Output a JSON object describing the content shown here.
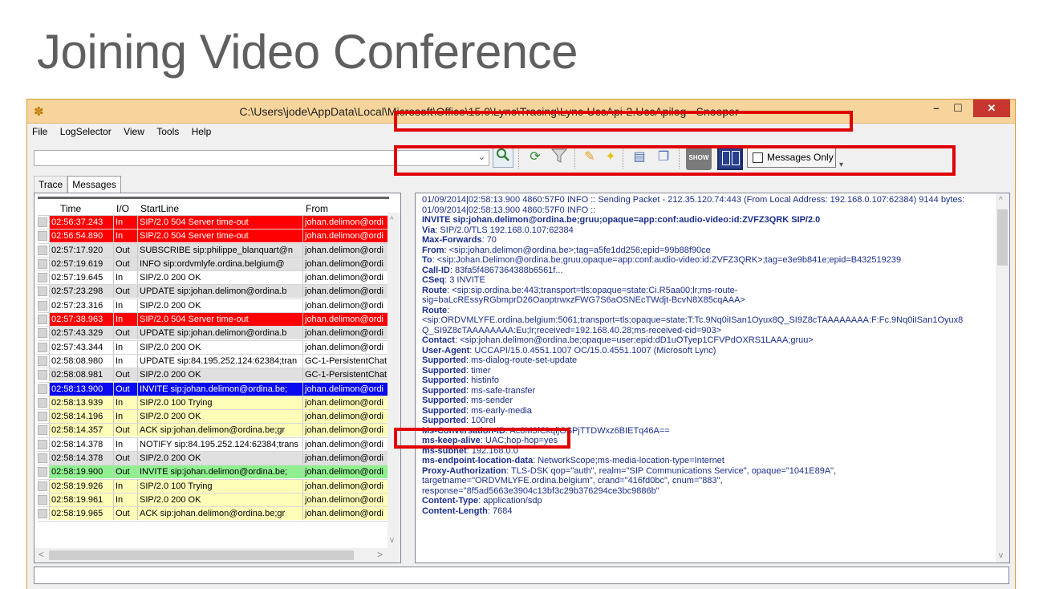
{
  "slide": {
    "title": "Joining Video Conference"
  },
  "window": {
    "title": "C:\\Users\\jode\\AppData\\Local\\Microsoft\\Office\\15.0\\Lync\\Tracing\\Lync-UccApi-2.UccApilog - Snooper",
    "controls": {
      "minimize": "–",
      "maximize": "☐",
      "close": "✕"
    },
    "icon": "bug-icon"
  },
  "menu": [
    "File",
    "LogSelector",
    "View",
    "Tools",
    "Help"
  ],
  "toolbar": {
    "search_value": "",
    "show_label": "SHOW",
    "messages_only_label": "Messages Only",
    "messages_only_checked": false,
    "icons": [
      "search-icon",
      "refresh-icon",
      "filter-icon",
      "marker-icon",
      "pin-icon",
      "document-icon",
      "copy-icon",
      "show-icon",
      "panes-icon"
    ]
  },
  "tabs": [
    {
      "label": "Trace",
      "active": false
    },
    {
      "label": "Messages",
      "active": true
    }
  ],
  "grid": {
    "columns": [
      "Time",
      "I/O",
      "StartLine",
      "From"
    ],
    "rows": [
      {
        "time": "02:56:37.243",
        "io": "In",
        "start": "SIP/2.0 504 Server time-out",
        "from": "johan.delimon@ordi",
        "color": "red"
      },
      {
        "time": "02:56:54.890",
        "io": "In",
        "start": "SIP/2.0 504 Server time-out",
        "from": "johan.delimon@ordi",
        "color": "red"
      },
      {
        "time": "02:57:17.920",
        "io": "Out",
        "start": "SUBSCRIBE sip:philippe_blanquart@n",
        "from": "johan.delimon@ordi",
        "color": "gray"
      },
      {
        "time": "02:57:19.619",
        "io": "Out",
        "start": "INFO sip:ordvmlyfe.ordina.belgium@",
        "from": "johan.delimon@ordi",
        "color": "gray"
      },
      {
        "time": "02:57:19.645",
        "io": "In",
        "start": "SIP/2.0 200 OK",
        "from": "johan.delimon@ordi",
        "color": "white"
      },
      {
        "time": "02:57:23.298",
        "io": "Out",
        "start": "UPDATE sip:johan.delimon@ordina.b",
        "from": "johan.delimon@ordi",
        "color": "gray"
      },
      {
        "time": "02:57:23.316",
        "io": "In",
        "start": "SIP/2.0 200 OK",
        "from": "johan.delimon@ordi",
        "color": "white"
      },
      {
        "time": "02:57:38.963",
        "io": "In",
        "start": "SIP/2.0 504 Server time-out",
        "from": "johan.delimon@ordi",
        "color": "red"
      },
      {
        "time": "02:57:43.329",
        "io": "Out",
        "start": "UPDATE sip:johan.delimon@ordina.b",
        "from": "johan.delimon@ordi",
        "color": "gray"
      },
      {
        "time": "02:57:43.344",
        "io": "In",
        "start": "SIP/2.0 200 OK",
        "from": "johan.delimon@ordi",
        "color": "white"
      },
      {
        "time": "02:58:08.980",
        "io": "In",
        "start": "UPDATE sip:84.195.252.124:62384;tran",
        "from": "GC-1-PersistentChat",
        "color": "white"
      },
      {
        "time": "02:58:08.981",
        "io": "Out",
        "start": "SIP/2.0 200 OK",
        "from": "GC-1-PersistentChat",
        "color": "gray"
      },
      {
        "time": "02:58:13.900",
        "io": "Out",
        "start": "INVITE sip:johan.delimon@ordina.be;",
        "from": "johan.delimon@ordi",
        "color": "blue"
      },
      {
        "time": "02:58:13.939",
        "io": "In",
        "start": "SIP/2.0 100 Trying",
        "from": "johan.delimon@ordi",
        "color": "yellow"
      },
      {
        "time": "02:58:14.196",
        "io": "In",
        "start": "SIP/2.0 200 OK",
        "from": "johan.delimon@ordi",
        "color": "yellow"
      },
      {
        "time": "02:58:14.357",
        "io": "Out",
        "start": "ACK sip:johan.delimon@ordina.be;gr",
        "from": "johan.delimon@ordi",
        "color": "yellow"
      },
      {
        "time": "02:58:14.378",
        "io": "In",
        "start": "NOTIFY sip:84.195.252.124:62384;trans",
        "from": "johan.delimon@ordi",
        "color": "white"
      },
      {
        "time": "02:58:14.378",
        "io": "Out",
        "start": "SIP/2.0 200 OK",
        "from": "johan.delimon@ordi",
        "color": "gray"
      },
      {
        "time": "02:58:19.900",
        "io": "Out",
        "start": "INVITE sip:johan.delimon@ordina.be;",
        "from": "johan.delimon@ordi",
        "color": "green"
      },
      {
        "time": "02:58:19.926",
        "io": "In",
        "start": "SIP/2.0 100 Trying",
        "from": "johan.delimon@ordi",
        "color": "yellow"
      },
      {
        "time": "02:58:19.961",
        "io": "In",
        "start": "SIP/2.0 200 OK",
        "from": "johan.delimon@ordi",
        "color": "yellow"
      },
      {
        "time": "02:58:19.965",
        "io": "Out",
        "start": "ACK sip:johan.delimon@ordina.be;gr",
        "from": "johan.delimon@ordi",
        "color": "yellow"
      }
    ]
  },
  "detail": {
    "lines": [
      {
        "k": "",
        "v": "01/09/2014|02:58:13.900 4860:57F0 INFO :: Sending Packet - 212.35.120.74:443 (From Local Address: 192.168.0.107:62384) 9144 bytes:"
      },
      {
        "k": "",
        "v": "01/09/2014|02:58:13.900 4860:57F0 INFO ::"
      },
      {
        "k": "INVITE sip:johan.delimon@ordina.be;gruu;opaque=app:conf:audio-video:id:ZVFZ3QRK SIP/2.0",
        "v": ""
      },
      {
        "k": "Via",
        "v": ": SIP/2.0/TLS 192.168.0.107:62384"
      },
      {
        "k": "Max-Forwards",
        "v": ": 70"
      },
      {
        "k": "From",
        "v": ": <sip:johan.delimon@ordina.be>;tag=a5fe1dd256;epid=99b88f90ce"
      },
      {
        "k": "To",
        "v": ": <sip:Johan.Delimon@ordina.be;gruu;opaque=app:conf:audio-video:id:ZVFZ3QRK>;tag=e3e9b841e;epid=B432519239"
      },
      {
        "k": "Call-ID",
        "v": ": 83fa5f4867364388b6561f..."
      },
      {
        "k": "CSeq",
        "v": ": 3 INVITE"
      },
      {
        "k": "Route",
        "v": ": <sip:sip.ordina.be:443;transport=tls;opaque=state:Ci.R5aa00;lr;ms-route-"
      },
      {
        "k": "",
        "v": "sig=baLcREssyRGbmprD26OaoptrwxzFWG7S6aOSNEcTWdjt-BcvN8X85cqAAA>"
      },
      {
        "k": "Route",
        "v": ":"
      },
      {
        "k": "",
        "v": "<sip:ORDVMLYFE.ordina.belgium:5061;transport=tls;opaque=state:T:Tc.9Nq0iISan1Oyux8Q_SI9Z8cTAAAAAAAA:F:Fc.9Nq0iISan1Oyux8"
      },
      {
        "k": "",
        "v": "Q_SI9Z8cTAAAAAAAA:Eu;lr;received=192.168.40.28;ms-received-cid=903>"
      },
      {
        "k": "Contact",
        "v": ": <sip:johan.delimon@ordina.be;opaque=user:epid:dD1uOTyep1CFVPdOXRS1LAAA;gruu>"
      },
      {
        "k": "User-Agent",
        "v": ": UCCAPI/15.0.4551.1007 OC/15.0.4551.1007 (Microsoft Lync)"
      },
      {
        "k": "Supported",
        "v": ": ms-dialog-route-set-update"
      },
      {
        "k": "Supported",
        "v": ": timer"
      },
      {
        "k": "Supported",
        "v": ": histinfo"
      },
      {
        "k": "Supported",
        "v": ": ms-safe-transfer"
      },
      {
        "k": "Supported",
        "v": ": ms-sender"
      },
      {
        "k": "Supported",
        "v": ": ms-early-media"
      },
      {
        "k": "Supported",
        "v": ": 100rel"
      },
      {
        "k": "Ms-Conversation-ID",
        "v": ": Ac8M3fCkqljGSPjTTDWxz6BIETq46A=="
      },
      {
        "k": "ms-keep-alive",
        "v": ": UAC;hop-hop=yes"
      },
      {
        "k": "ms-subnet",
        "v": ": 192.168.0.0"
      },
      {
        "k": "ms-endpoint-location-data",
        "v": ": NetworkScope;ms-media-location-type=Internet"
      },
      {
        "k": "Proxy-Authorization",
        "v": ": TLS-DSK qop=\"auth\", realm=\"SIP Communications Service\", opaque=\"1041E89A\","
      },
      {
        "k": "",
        "v": "targetname=\"ORDVMLYFE.ordina.belgium\", crand=\"416fd0bc\", cnum=\"883\","
      },
      {
        "k": "",
        "v": "response=\"8f5ad5663e3904c13bf3c29b376294ce3bc9886b\""
      },
      {
        "k": "Content-Type",
        "v": ": application/sdp"
      },
      {
        "k": "Content-Length",
        "v": ": 7684"
      }
    ]
  },
  "status": {
    "text": ""
  },
  "colors": {
    "red": "#fe0000",
    "yellow": "#fdfdb7",
    "gray": "#e0e0e0",
    "blue": "#0a0af0",
    "green": "#90f090",
    "highlight": "#e00000",
    "detail_text": "#1b2e8c"
  }
}
